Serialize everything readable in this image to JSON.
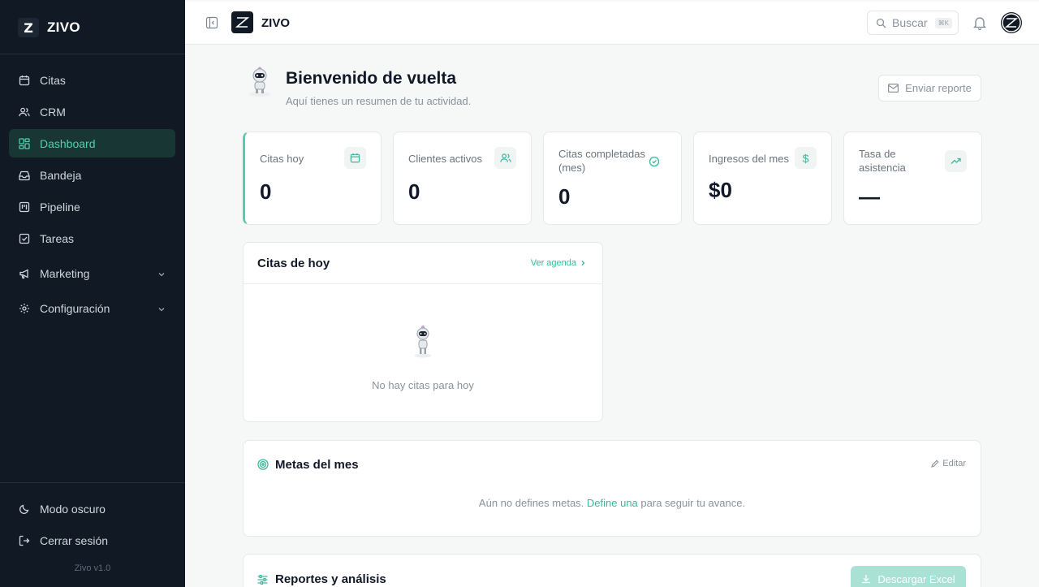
{
  "sidebar": {
    "brand": "ZIVO",
    "logo_letter": "Z",
    "items": [
      {
        "label": "Citas",
        "icon": "calendar-icon"
      },
      {
        "label": "CRM",
        "icon": "users-icon"
      },
      {
        "label": "Dashboard",
        "icon": "dashboard-icon",
        "active": true
      },
      {
        "label": "Bandeja",
        "icon": "inbox-icon"
      },
      {
        "label": "Pipeline",
        "icon": "kanban-icon"
      },
      {
        "label": "Tareas",
        "icon": "checkbox-icon"
      },
      {
        "label": "Marketing",
        "icon": "megaphone-icon"
      },
      {
        "label": "Configuración",
        "icon": "gear-icon"
      }
    ],
    "dark_mode": "Modo oscuro",
    "logout": "Cerrar sesión",
    "version": "Zivo v1.0"
  },
  "topbar": {
    "brand": "ZIVO",
    "search_placeholder": "Buscar",
    "search_shortcut": "⌘K"
  },
  "welcome": {
    "title": "Bienvenido de vuelta",
    "subtitle": "Aquí tienes un resumen de tu actividad.",
    "report_button": "Enviar reporte"
  },
  "stats": [
    {
      "label": "Citas hoy",
      "value": "0",
      "icon": "calendar-icon"
    },
    {
      "label": "Clientes activos",
      "value": "0",
      "icon": "users-icon"
    },
    {
      "label": "Citas completadas (mes)",
      "value": "0",
      "icon": "check-circle-icon"
    },
    {
      "label": "Ingresos del mes",
      "value": "$0",
      "icon": "dollar-icon"
    },
    {
      "label": "Tasa de asistencia",
      "value": "—",
      "icon": "trending-up-icon"
    }
  ],
  "today": {
    "title": "Citas de hoy",
    "link": "Ver agenda",
    "empty": "No hay citas para hoy"
  },
  "goals": {
    "title": "Metas del mes",
    "edit": "Editar",
    "text_before": "Aún no defines metas.",
    "link": "Define una",
    "text_after": "para seguir tu avance."
  },
  "reports": {
    "title": "Reportes y análisis",
    "download": "Descargar Excel"
  },
  "colors": {
    "sidebar_bg": "#111a24",
    "accent": "#3bb79b",
    "active_bg": "#173634"
  }
}
